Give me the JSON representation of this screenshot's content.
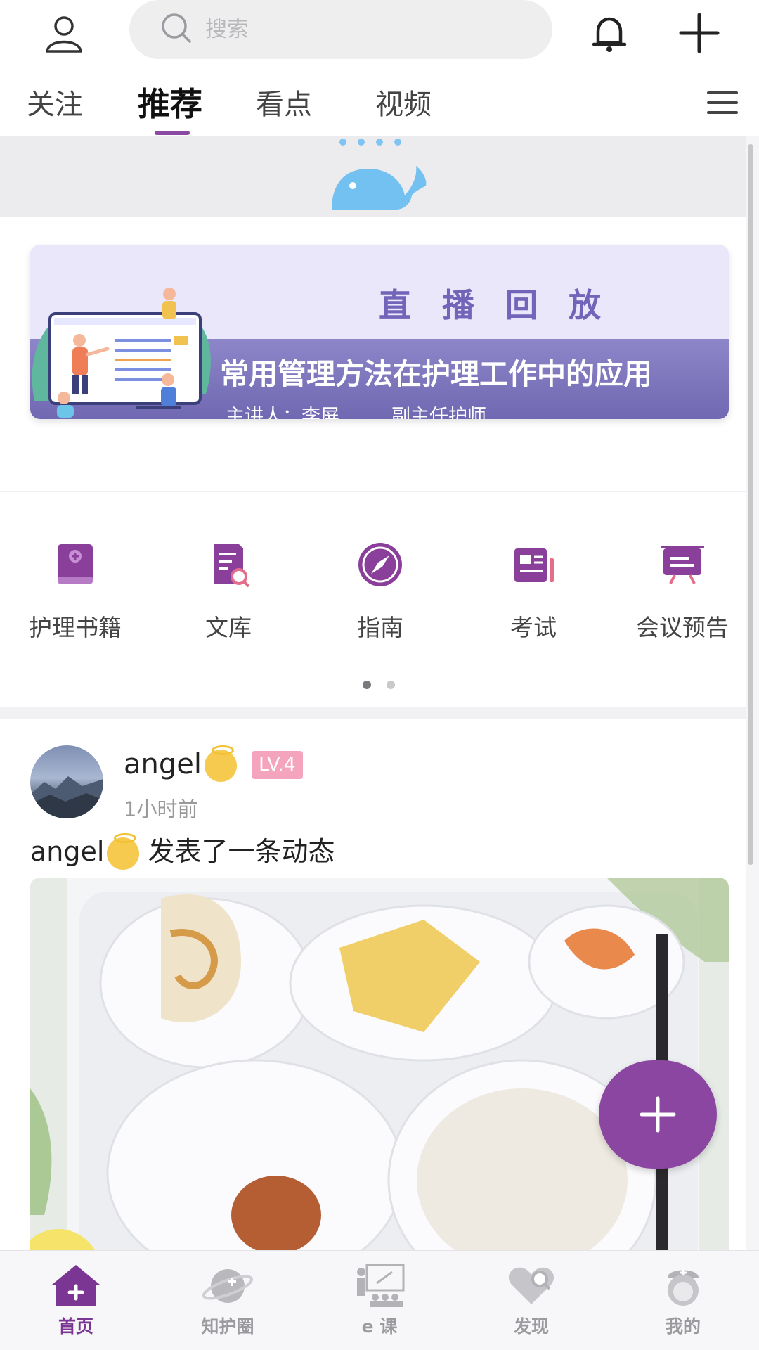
{
  "header": {
    "search_placeholder": "搜索"
  },
  "tabs": [
    {
      "label": "关注"
    },
    {
      "label": "推荐",
      "active": true
    },
    {
      "label": "看点"
    },
    {
      "label": "视频"
    }
  ],
  "banner": {
    "title": "直 播 回 放",
    "subtitle": "常用管理方法在护理工作中的应用",
    "speaker": "主讲人：李屏",
    "role": "副主任护师"
  },
  "quick_links": [
    {
      "label": "护理书籍",
      "icon": "book-icon"
    },
    {
      "label": "文库",
      "icon": "document-search-icon"
    },
    {
      "label": "指南",
      "icon": "compass-icon"
    },
    {
      "label": "考试",
      "icon": "exam-icon"
    },
    {
      "label": "会议预告",
      "icon": "presentation-board-icon"
    }
  ],
  "quick_links_pages": {
    "total": 2,
    "current": 1
  },
  "post": {
    "username": "angel",
    "level": "LV.4",
    "time": "1小时前",
    "text_suffix": " 发表了一条动态"
  },
  "bottom_nav": [
    {
      "label": "首页",
      "icon": "home-icon",
      "active": true
    },
    {
      "label": "知护圈",
      "icon": "planet-icon"
    },
    {
      "label": "e 课",
      "icon": "classroom-icon"
    },
    {
      "label": "发现",
      "icon": "discover-icon"
    },
    {
      "label": "我的",
      "icon": "nurse-profile-icon"
    }
  ],
  "colors": {
    "accent": "#8a46a0",
    "banner_band": "#7d76bf",
    "level_badge": "#f4a4bc"
  }
}
